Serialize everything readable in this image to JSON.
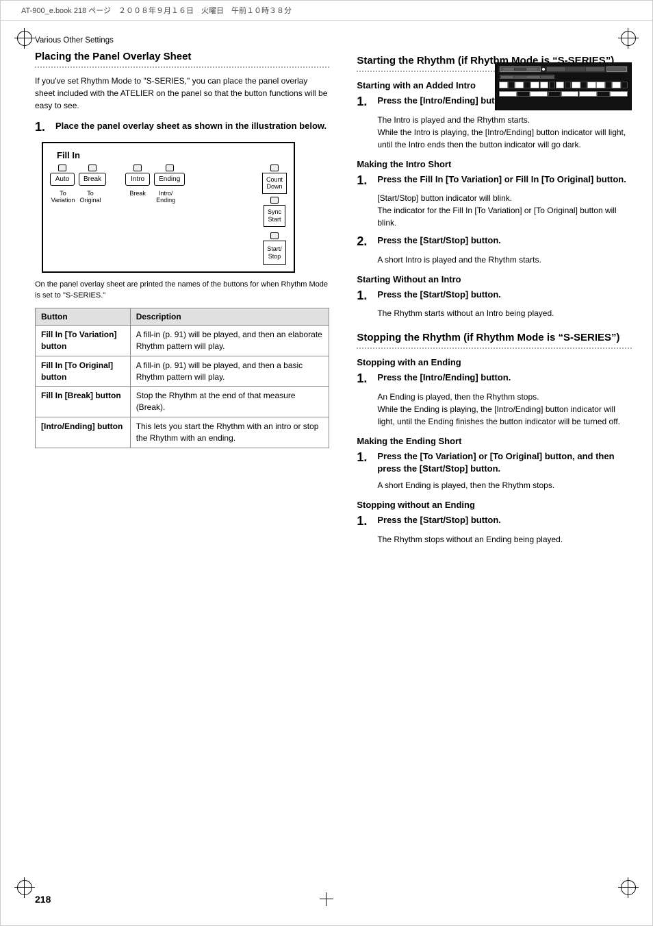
{
  "header": {
    "file_info": "AT-900_e.book  218 ページ　２００８年９月１６日　火曜日　午前１０時３８分"
  },
  "page": {
    "number": "218",
    "section_label": "Various Other Settings"
  },
  "left_section": {
    "heading": "Placing the Panel Overlay Sheet",
    "intro_text": "If you've set Rhythm Mode to \"S-SERIES,\" you can place the panel overlay sheet included with the ATELIER on the panel so that the button functions will be easy to see.",
    "step1": {
      "number": "1.",
      "text": "Place the panel overlay sheet as shown in the illustration below."
    },
    "panel_overlay": {
      "fill_in_label": "Fill In",
      "buttons": {
        "auto": "Auto",
        "break": "Break",
        "intro": "Intro",
        "ending": "Ending",
        "to_variation": "To\nVariation",
        "to_original": "To\nOriginal",
        "break_label": "Break",
        "intro_ending": "Intro/\nEnding",
        "count_down": "Count\nDown",
        "sync_start": "Sync\nStart",
        "start_stop": "Start/\nStop"
      }
    },
    "caption": "On the panel overlay sheet are printed the names of the buttons for when Rhythm Mode is set to \"S-SERIES.\"",
    "table": {
      "headers": [
        "Button",
        "Description"
      ],
      "rows": [
        {
          "button": "Fill In [To Variation] button",
          "description": "A fill-in (p. 91) will be played, and then an elaborate Rhythm pattern will play."
        },
        {
          "button": "Fill In [To Original] button",
          "description": "A fill-in (p. 91) will be played, and then a basic Rhythm pattern will play."
        },
        {
          "button": "Fill In [Break] button",
          "description": "Stop the Rhythm at the end of that measure (Break)."
        },
        {
          "button": "[Intro/Ending] button",
          "description": "This lets you start the Rhythm with an intro or stop the Rhythm with an ending."
        }
      ]
    }
  },
  "right_section": {
    "heading": "Starting the Rhythm (if Rhythm Mode is “S-SERIES”)",
    "subsections": [
      {
        "heading": "Starting with an Added Intro",
        "steps": [
          {
            "number": "1.",
            "bold_text": "Press the [Intro/Ending] button.",
            "normal_text": "The Intro is played and the Rhythm starts.\nWhile the Intro is playing, the [Intro/Ending] button indicator will light, until the Intro ends then the button indicator will go dark."
          }
        ]
      },
      {
        "heading": "Making the Intro Short",
        "steps": [
          {
            "number": "1.",
            "bold_text": "Press the Fill In [To Variation] or Fill In [To Original] button.",
            "normal_text": "[Start/Stop] button indicator will blink.\nThe indicator for the Fill In [To Variation] or [To Original] button will blink."
          },
          {
            "number": "2.",
            "bold_text": "Press the [Start/Stop] button.",
            "normal_text": "A short Intro is played and the Rhythm starts."
          }
        ]
      },
      {
        "heading": "Starting Without an Intro",
        "steps": [
          {
            "number": "1.",
            "bold_text": "Press the [Start/Stop] button.",
            "normal_text": "The Rhythm starts without an Intro being played."
          }
        ]
      }
    ],
    "heading2": "Stopping the Rhythm (if Rhythm Mode is “S-SERIES”)",
    "subsections2": [
      {
        "heading": "Stopping with an Ending",
        "steps": [
          {
            "number": "1.",
            "bold_text": "Press the [Intro/Ending] button.",
            "normal_text": "An Ending is played, then the Rhythm stops.\nWhile the Ending is playing, the [Intro/Ending] button indicator will light, until the Ending finishes the button indicator will be turned off."
          }
        ]
      },
      {
        "heading": "Making the Ending Short",
        "steps": [
          {
            "number": "1.",
            "bold_text": "Press the [To Variation] or [To Original] button, and then press the [Start/Stop] button.",
            "normal_text": "A short Ending is played, then the Rhythm stops."
          }
        ]
      },
      {
        "heading": "Stopping without an Ending",
        "steps": [
          {
            "number": "1.",
            "bold_text": "Press the [Start/Stop] button.",
            "normal_text": "The Rhythm stops without an Ending being played."
          }
        ]
      }
    ]
  }
}
